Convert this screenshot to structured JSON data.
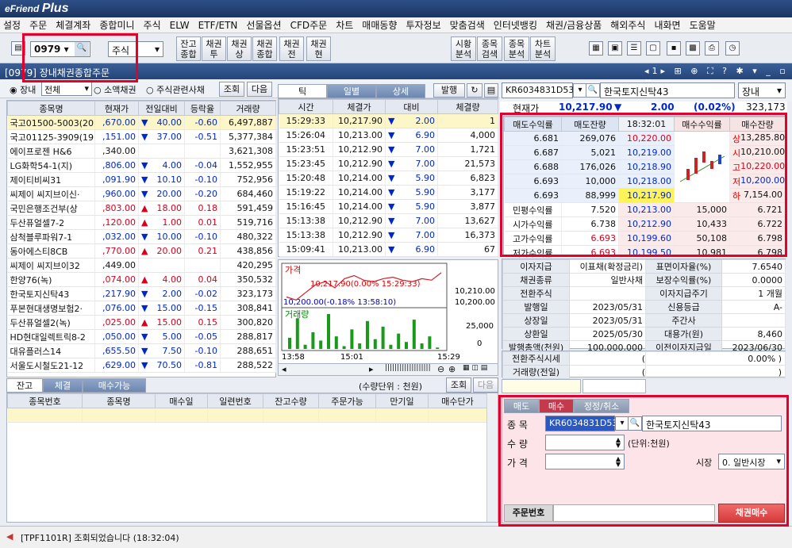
{
  "app": {
    "logo": "eFriend",
    "logo_plus": "Plus"
  },
  "menu": [
    "설정",
    "주문",
    "체결계좌",
    "종합미니",
    "주식",
    "ELW",
    "ETF/ETN",
    "선물옵션",
    "CFD주문",
    "차트",
    "매매동향",
    "투자정보",
    "맞춤검색",
    "인터넷뱅킹",
    "채권/금융상품",
    "해외주식",
    "내화면",
    "도움말"
  ],
  "toolbar": {
    "screen_no": "0979",
    "market": "주식",
    "buttons": [
      "잔고 종합",
      "채권 투",
      "채권 상",
      "채권 종합",
      "채권 전",
      "채권 현"
    ],
    "buttons2": [
      "시황 분석",
      "종목 검색",
      "종목 분석",
      "차트 분석"
    ]
  },
  "window": {
    "title": "[0979] 장내채권종합주문"
  },
  "subbar": {
    "radio1": "장내",
    "select": "전체",
    "radio2": "소액채권",
    "radio3": "주식관련사채",
    "query": "조회",
    "next": "다음"
  },
  "list": {
    "headers": [
      "종목명",
      "현재가",
      "전일대비",
      "등락율",
      "거래량"
    ],
    "rows": [
      [
        "국고01500-5003(20",
        ",670.00",
        "▼",
        "40.00",
        "-0.60",
        "6,497,887"
      ],
      [
        "국고01125-3909(19",
        ",151.00",
        "▼",
        "37.00",
        "-0.51",
        "5,377,384"
      ],
      [
        "에이프로젠 H&6",
        ",340.00",
        "",
        "",
        "",
        "3,621,308"
      ],
      [
        "LG화학54-1(지)",
        ",806.00",
        "▼",
        "4.00",
        "-0.04",
        "1,552,955"
      ],
      [
        "제이티비씨31",
        ",091.90",
        "▼",
        "10.10",
        "-0.10",
        "752,956"
      ],
      [
        "씨제이 씨지브이신·",
        ",960.00",
        "▼",
        "20.00",
        "-0.20",
        "684,460"
      ],
      [
        "국민은행조건부(상",
        ",803.00",
        "▲",
        "18.00",
        "0.18",
        "591,459"
      ],
      [
        "두산퓨얼셀7-2",
        ",120.00",
        "▲",
        "1.00",
        "0.01",
        "519,716"
      ],
      [
        "삼척블루파워7-1",
        ",032.00",
        "▼",
        "10.00",
        "-0.10",
        "480,322"
      ],
      [
        "동아에스티8CB",
        ",770.00",
        "▲",
        "20.00",
        "0.21",
        "438,856"
      ],
      [
        "씨제이 씨지브이32",
        ",449.00",
        "",
        "",
        "",
        "420,295"
      ],
      [
        "한양76(녹)",
        ",074.00",
        "▲",
        "4.00",
        "0.04",
        "350,532"
      ],
      [
        "한국토지신탁43",
        ",217.90",
        "▼",
        "2.00",
        "-0.02",
        "323,173"
      ],
      [
        "푸본현대생명보험2·",
        ",076.00",
        "▼",
        "15.00",
        "-0.15",
        "308,841"
      ],
      [
        "두산퓨얼셀2(녹)",
        ",025.00",
        "▲",
        "15.00",
        "0.15",
        "300,820"
      ],
      [
        "HD현대일렉트릭8-2",
        ",050.00",
        "▼",
        "5.00",
        "-0.05",
        "288,817"
      ],
      [
        "대유플러스14",
        ",655.50",
        "▼",
        "7.50",
        "-0.10",
        "288,651"
      ],
      [
        "서울도시철도21-12",
        ",629.00",
        "▼",
        "70.50",
        "-0.81",
        "288,522"
      ]
    ]
  },
  "tick": {
    "tabs": [
      "틱",
      "일별",
      "상세"
    ],
    "extra": "발행",
    "headers": [
      "시간",
      "체결가",
      "대비",
      "체결량"
    ],
    "rows": [
      [
        "15:29:33",
        "10,217.90",
        "▼",
        "2.00",
        "1"
      ],
      [
        "15:26:04",
        "10,213.00",
        "▼",
        "6.90",
        "4,000"
      ],
      [
        "15:23:51",
        "10,212.90",
        "▼",
        "7.00",
        "1,721"
      ],
      [
        "15:23:45",
        "10,212.90",
        "▼",
        "7.00",
        "21,573"
      ],
      [
        "15:20:48",
        "10,214.00",
        "▼",
        "5.90",
        "6,823"
      ],
      [
        "15:19:22",
        "10,214.00",
        "▼",
        "5.90",
        "3,177"
      ],
      [
        "15:16:45",
        "10,214.00",
        "▼",
        "5.90",
        "3,877"
      ],
      [
        "15:13:38",
        "10,212.90",
        "▼",
        "7.00",
        "13,627"
      ],
      [
        "15:13:38",
        "10,212.90",
        "▼",
        "7.00",
        "16,373"
      ],
      [
        "15:09:41",
        "10,213.00",
        "▼",
        "6.90",
        "67"
      ]
    ]
  },
  "chart": {
    "price_label": "가격",
    "high_note": "10,217.90(0.00% 15:29:33)",
    "low_note": "10,200.00(-0.18% 13:58:10)",
    "y1": "10,210.00",
    "y2": "10,200.00",
    "vol_label": "거래량",
    "vy1": "25,000",
    "vy2": "0",
    "x_ticks": [
      "13:58",
      "15:01",
      "15:29"
    ],
    "price_series": [
      10202,
      10200,
      10205,
      10210,
      10212,
      10208,
      10214,
      10216,
      10213,
      10212,
      10214,
      10215,
      10213,
      10212,
      10214,
      10213,
      10217.9
    ],
    "volume_series": [
      8000,
      22000,
      3000,
      12000,
      6000,
      25000,
      9000,
      2000,
      14000,
      4000,
      20000,
      7000,
      16000,
      3000,
      11000,
      5000,
      21000,
      4000,
      9000,
      1000
    ]
  },
  "bottom": {
    "tabs": [
      "잔고",
      "체결",
      "매수가능"
    ],
    "unit": "(수량단위 : 천원)",
    "query": "조회",
    "next": "다음",
    "headers": [
      "종목번호",
      "종목명",
      "매수일",
      "일련번호",
      "잔고수량",
      "주문가능",
      "만기일",
      "매수단가"
    ]
  },
  "quote": {
    "code": "KR6034831D53",
    "name": "한국토지신탁43",
    "market": "장내",
    "label_price": "현재가",
    "price": "10,217.90",
    "change_dir": "▼",
    "change": "2.00",
    "rate": "0.02%",
    "volume": "323,173",
    "headers": [
      "매도수익률",
      "매도잔량",
      "18:32:01",
      "매수수익률",
      "매수잔량"
    ],
    "asks": [
      [
        "6.681",
        "269,076",
        "10,220.00"
      ],
      [
        "6.687",
        "5,021",
        "10,219.00"
      ],
      [
        "6.688",
        "176,026",
        "10,218.90"
      ],
      [
        "6.693",
        "10,000",
        "10,218.00"
      ],
      [
        "6.693",
        "88,999",
        "10,217.90"
      ]
    ],
    "bids": [
      [
        "10,213.00",
        "15,000",
        "6.721"
      ],
      [
        "10,212.90",
        "10,433",
        "6.722"
      ],
      [
        "10,199.60",
        "50,108",
        "6.798"
      ],
      [
        "10,199.50",
        "10,981",
        "6.798"
      ],
      [
        "10,171.00",
        "120",
        "6.962"
      ]
    ],
    "yields": [
      [
        "민평수익률",
        "7.520"
      ],
      [
        "시가수익률",
        "6.738"
      ],
      [
        "고가수익률",
        "6.693"
      ],
      [
        "저가수익률",
        "6.693"
      ]
    ],
    "ohlc": [
      [
        "상",
        "13,285.80"
      ],
      [
        "시",
        "10,210.00"
      ],
      [
        "고",
        "10,220.00"
      ],
      [
        "저",
        "10,200.00"
      ],
      [
        "하",
        "7,154.00"
      ]
    ],
    "total_ask": "692,535",
    "total_diff": "-604,653",
    "total_bid": "87,882"
  },
  "info": [
    [
      "이자지급",
      "이표채(확정금리)",
      "표면이자율(%)",
      "7.6540"
    ],
    [
      "채권종류",
      "일반사채",
      "보장수익률(%)",
      "0.0000"
    ],
    [
      "전환주식",
      "",
      "이자지급주기",
      "1 개월"
    ],
    [
      "발행일",
      "2023/05/31",
      "신용등급",
      "A-"
    ],
    [
      "상장일",
      "2023/05/31",
      "주간사",
      ""
    ],
    [
      "상환일",
      "2025/05/30",
      "대용가(원)",
      "8,460"
    ],
    [
      "발행총액(천원)",
      "100,000,000",
      "이전이자지급일",
      "2023/06/30"
    ]
  ],
  "conv": [
    [
      "전환주식시세",
      "(",
      "0.00%  )"
    ],
    [
      "거래량(전일)",
      "(",
      ")"
    ]
  ],
  "order": {
    "tabs": [
      "매도",
      "매수",
      "정정/취소"
    ],
    "label_code": "종  목",
    "code": "KR6034831D53",
    "name": "한국토지신탁43",
    "label_qty": "수  량",
    "unit": "(단위:천원)",
    "label_price": "가  격",
    "label_market": "시장",
    "market": "0. 일반시장",
    "label_acct": "주문번호",
    "buy_button": "채권매수"
  },
  "status": {
    "msg": "[TPF1101R] 조회되었습니다 (18:32:04)"
  }
}
